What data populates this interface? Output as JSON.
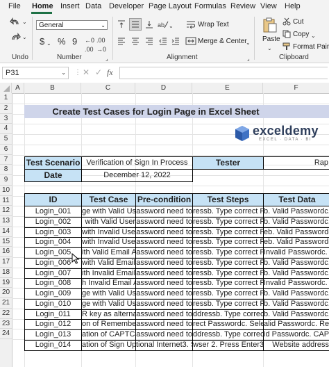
{
  "menu": {
    "tabs": [
      "File",
      "Home",
      "Insert",
      "Data",
      "Developer",
      "Page Layout",
      "Formulas",
      "Review",
      "View",
      "Help"
    ]
  },
  "ribbon": {
    "undo_label": "Undo",
    "number_label": "Number",
    "alignment_label": "Alignment",
    "clipboard_label": "Clipboard",
    "number_format": "General",
    "currency_symbol": "$",
    "percent_symbol": "%",
    "comma_symbol": "9",
    "wrap_text": "Wrap Text",
    "merge_center": "Merge & Center",
    "paste": "Paste",
    "cut": "Cut",
    "copy": "Copy",
    "format_painter": "Format Painter"
  },
  "formula_bar": {
    "name_box": "P31",
    "fx": "fx",
    "value": ""
  },
  "columns": [
    "A",
    "B",
    "C",
    "D",
    "E",
    "F"
  ],
  "rows": [
    "1",
    "2",
    "3",
    "4",
    "5",
    "6",
    "7",
    "8",
    "9",
    "10",
    "11",
    "12",
    "13",
    "14",
    "15",
    "16",
    "17",
    "18",
    "19",
    "20",
    "21",
    "22",
    "23",
    "24"
  ],
  "sheet": {
    "title": "Create Test Cases for Login Page in Excel Sheet",
    "logo_name": "exceldemy",
    "logo_tagline": "EXCEL · DATA · BI",
    "test_scenario_label": "Test Scenario",
    "test_scenario_value": "Verification of Sign In Process",
    "tester_label": "Tester",
    "tester_value": "Rap",
    "date_label": "Date",
    "date_value": "December 12, 2022",
    "headers": [
      "ID",
      "Test Case",
      "Pre-condition",
      "Test Steps",
      "Test Data"
    ],
    "table": [
      [
        "Login_001",
        "ge with Valid Us",
        "assword need to",
        "ressb. Type correct Pa",
        "b. Valid Passwordc. B"
      ],
      [
        "Login_002",
        "with Valid User",
        "assword need to",
        "ressb. Type correct Pa",
        "b. Valid Passwordc. B"
      ],
      [
        "Login_003",
        "with Invalid Use",
        "assword need to",
        "ressb. Type correct Pa",
        "eb. Valid Passwordc. B"
      ],
      [
        "Login_004",
        "with Invalid Use",
        "assword need to",
        "ressb. Type correct Pa",
        "eb. Valid Passwordc. B"
      ],
      [
        "Login_005",
        "ith Valid Email A",
        "assword need to",
        "ressb. Type correct Pa",
        "Invalid Passwordc. B"
      ],
      [
        "Login_006",
        "with Valid Email A",
        "assword need to",
        "ressb. Type correct Pa",
        "b. Valid Passwordc. B"
      ],
      [
        "Login_007",
        "ith Invalid Email",
        "assword need to",
        "ressb. Type correct Pa",
        "b. Valid Passwordc. B"
      ],
      [
        "Login_008",
        "h Invalid Email A",
        "assword need to",
        "ressb. Type correct Pa",
        "Invalid Passwordc. B"
      ],
      [
        "Login_009",
        "ge with Valid Us",
        "assword need to",
        "ressb. Type correct Pa",
        "b. Valid Passwordc. B"
      ],
      [
        "Login_010",
        "ge with Valid Us",
        "assword need to",
        "ressb. Type correct Pa",
        "b. Valid Passwordc. Butt"
      ],
      [
        "Login_011",
        "R key as alternat",
        "assword need to",
        "ddressb. Type correct Pa",
        "b. Valid Passwordc. ENT"
      ],
      [
        "Login_012",
        "on of Remember P",
        "assword need to",
        "rect Passwordc. Select",
        "alid Passwordc. Remem"
      ],
      [
        "Login_013",
        "ation of CAPTCHA",
        "assword need to",
        "ddressb. Type correct P",
        "id Passwordc. CAPTCH"
      ],
      [
        "Login_014",
        "ation of Sign Up",
        "tional Internet3. S",
        "wser 2. Press Enter3. C",
        "Website address"
      ]
    ]
  },
  "colors": {
    "accent": "#1e7145",
    "title_fill": "#cfd5ea",
    "header_fill": "#c6e2f5"
  }
}
